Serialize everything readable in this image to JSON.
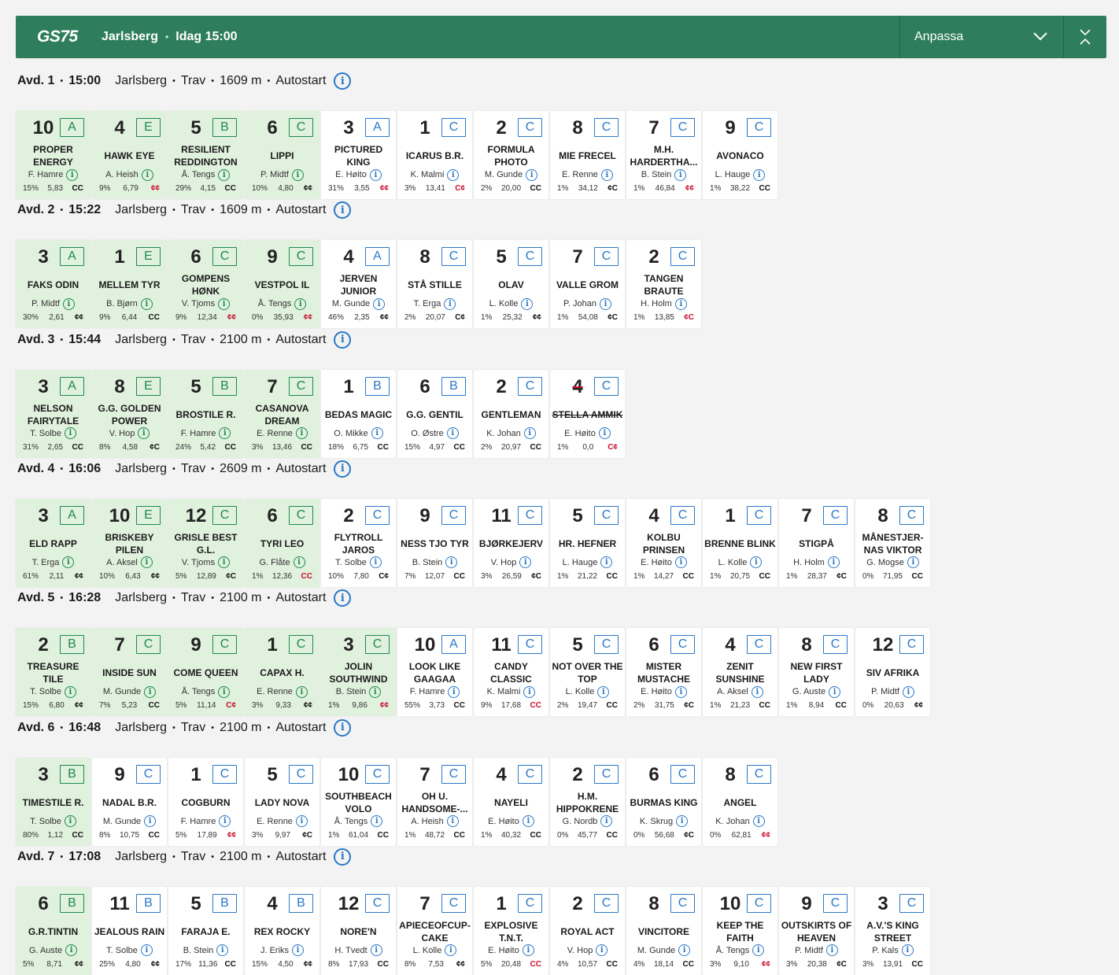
{
  "header": {
    "logo": "GS75",
    "track": "Jarlsberg",
    "time": "Idag 15:00",
    "customize_label": "Anpassa"
  },
  "races": [
    {
      "label": "Avd. 1",
      "time": "15:00",
      "track": "Jarlsberg",
      "type": "Trav",
      "distance": "1609 m",
      "start": "Autostart",
      "horses": [
        {
          "num": "10",
          "group": "A",
          "name": "PROPER ENERGY",
          "driver": "F. Hamre",
          "pct": "15%",
          "odds": "5,83",
          "sym": "CC",
          "sel": true
        },
        {
          "num": "4",
          "group": "E",
          "name": "HAWK EYE",
          "driver": "A. Heish",
          "pct": "9%",
          "odds": "6,79",
          "sym": "¢¢",
          "red": true,
          "sel": true
        },
        {
          "num": "5",
          "group": "B",
          "name": "RESILIENT REDDINGTON",
          "driver": "Å. Tengs",
          "pct": "29%",
          "odds": "4,15",
          "sym": "CC",
          "sel": true
        },
        {
          "num": "6",
          "group": "C",
          "name": "LIPPI",
          "driver": "P. Midtf",
          "pct": "10%",
          "odds": "4,80",
          "sym": "¢¢",
          "sel": true
        },
        {
          "num": "3",
          "group": "A",
          "name": "PICTURED KING",
          "driver": "E. Høito",
          "pct": "31%",
          "odds": "3,55",
          "sym": "¢¢",
          "red": true
        },
        {
          "num": "1",
          "group": "C",
          "name": "ICARUS B.R.",
          "driver": "K. Malmi",
          "pct": "3%",
          "odds": "13,41",
          "sym": "C¢",
          "red": true
        },
        {
          "num": "2",
          "group": "C",
          "name": "FORMULA PHOTO",
          "driver": "M. Gunde",
          "pct": "2%",
          "odds": "20,00",
          "sym": "CC"
        },
        {
          "num": "8",
          "group": "C",
          "name": "MIE FRECEL",
          "driver": "E. Renne",
          "pct": "1%",
          "odds": "34,12",
          "sym": "¢C"
        },
        {
          "num": "7",
          "group": "C",
          "name": "M.H. HARDERTHA...",
          "driver": "B. Stein",
          "pct": "1%",
          "odds": "46,84",
          "sym": "¢¢",
          "red": true
        },
        {
          "num": "9",
          "group": "C",
          "name": "AVONACO",
          "driver": "L. Hauge",
          "pct": "1%",
          "odds": "38,22",
          "sym": "CC"
        }
      ]
    },
    {
      "label": "Avd. 2",
      "time": "15:22",
      "track": "Jarlsberg",
      "type": "Trav",
      "distance": "1609 m",
      "start": "Autostart",
      "horses": [
        {
          "num": "3",
          "group": "A",
          "name": "FAKS ODIN",
          "driver": "P. Midtf",
          "pct": "30%",
          "odds": "2,61",
          "sym": "¢¢",
          "sel": true
        },
        {
          "num": "1",
          "group": "E",
          "name": "MELLEM TYR",
          "driver": "B. Bjørn",
          "pct": "9%",
          "odds": "6,44",
          "sym": "CC",
          "sel": true
        },
        {
          "num": "6",
          "group": "C",
          "name": "GOMPENS HØNK",
          "driver": "V. Tjoms",
          "pct": "9%",
          "odds": "12,34",
          "sym": "¢¢",
          "red": true,
          "sel": true
        },
        {
          "num": "9",
          "group": "C",
          "name": "VESTPOL IL",
          "driver": "Å. Tengs",
          "pct": "0%",
          "odds": "35,93",
          "sym": "¢¢",
          "red": true,
          "sel": true
        },
        {
          "num": "4",
          "group": "A",
          "name": "JERVEN JUNIOR",
          "driver": "M. Gunde",
          "pct": "46%",
          "odds": "2,35",
          "sym": "¢¢"
        },
        {
          "num": "8",
          "group": "C",
          "name": "STÅ STILLE",
          "driver": "T. Erga",
          "pct": "2%",
          "odds": "20,07",
          "sym": "C¢"
        },
        {
          "num": "5",
          "group": "C",
          "name": "OLAV",
          "driver": "L. Kolle",
          "pct": "1%",
          "odds": "25,32",
          "sym": "¢¢"
        },
        {
          "num": "7",
          "group": "C",
          "name": "VALLE GROM",
          "driver": "P. Johan",
          "pct": "1%",
          "odds": "54,08",
          "sym": "¢C"
        },
        {
          "num": "2",
          "group": "C",
          "name": "TANGEN BRAUTE",
          "driver": "H. Holm",
          "pct": "1%",
          "odds": "13,85",
          "sym": "¢C",
          "red": true
        }
      ]
    },
    {
      "label": "Avd. 3",
      "time": "15:44",
      "track": "Jarlsberg",
      "type": "Trav",
      "distance": "2100 m",
      "start": "Autostart",
      "horses": [
        {
          "num": "3",
          "group": "A",
          "name": "NELSON FAIRYTALE",
          "driver": "T. Solbe",
          "pct": "31%",
          "odds": "2,65",
          "sym": "CC",
          "sel": true
        },
        {
          "num": "8",
          "group": "E",
          "name": "G.G. GOLDEN POWER",
          "driver": "V. Hop",
          "pct": "8%",
          "odds": "4,58",
          "sym": "¢C",
          "sel": true
        },
        {
          "num": "5",
          "group": "B",
          "name": "BROSTILE R.",
          "driver": "F. Hamre",
          "pct": "24%",
          "odds": "5,42",
          "sym": "CC",
          "sel": true
        },
        {
          "num": "7",
          "group": "C",
          "name": "CASANOVA DREAM",
          "driver": "E. Renne",
          "pct": "3%",
          "odds": "13,46",
          "sym": "CC",
          "sel": true
        },
        {
          "num": "1",
          "group": "B",
          "name": "BEDAS MAGIC",
          "driver": "O. Mikke",
          "pct": "18%",
          "odds": "6,75",
          "sym": "CC"
        },
        {
          "num": "6",
          "group": "B",
          "name": "G.G. GENTIL",
          "driver": "O. Østre",
          "pct": "15%",
          "odds": "4,97",
          "sym": "CC"
        },
        {
          "num": "2",
          "group": "C",
          "name": "GENTLEMAN",
          "driver": "K. Johan",
          "pct": "2%",
          "odds": "20,97",
          "sym": "CC"
        },
        {
          "num": "4",
          "group": "C",
          "name": "STELLA AMMIK",
          "driver": "E. Høito",
          "pct": "1%",
          "odds": "0,0",
          "sym": "C¢",
          "red": true,
          "scr": true
        }
      ]
    },
    {
      "label": "Avd. 4",
      "time": "16:06",
      "track": "Jarlsberg",
      "type": "Trav",
      "distance": "2609 m",
      "start": "Autostart",
      "horses": [
        {
          "num": "3",
          "group": "A",
          "name": "ELD RAPP",
          "driver": "T. Erga",
          "pct": "61%",
          "odds": "2,11",
          "sym": "¢¢",
          "sel": true
        },
        {
          "num": "10",
          "group": "E",
          "name": "BRISKEBY PILEN",
          "driver": "A. Aksel",
          "pct": "10%",
          "odds": "6,43",
          "sym": "¢¢",
          "sel": true
        },
        {
          "num": "12",
          "group": "C",
          "name": "GRISLE BEST G.L.",
          "driver": "V. Tjoms",
          "pct": "5%",
          "odds": "12,89",
          "sym": "¢C",
          "sel": true
        },
        {
          "num": "6",
          "group": "C",
          "name": "TYRI LEO",
          "driver": "G. Flåte",
          "pct": "1%",
          "odds": "12,36",
          "sym": "CC",
          "red": true,
          "sel": true
        },
        {
          "num": "2",
          "group": "C",
          "name": "FLYTROLL JAROS",
          "driver": "T. Solbe",
          "pct": "10%",
          "odds": "7,80",
          "sym": "C¢"
        },
        {
          "num": "9",
          "group": "C",
          "name": "NESS TJO TYR",
          "driver": "B. Stein",
          "pct": "7%",
          "odds": "12,07",
          "sym": "CC"
        },
        {
          "num": "11",
          "group": "C",
          "name": "BJØRKEJERV",
          "driver": "V. Hop",
          "pct": "3%",
          "odds": "26,59",
          "sym": "¢C"
        },
        {
          "num": "5",
          "group": "C",
          "name": "HR. HEFNER",
          "driver": "L. Hauge",
          "pct": "1%",
          "odds": "21,22",
          "sym": "CC"
        },
        {
          "num": "4",
          "group": "C",
          "name": "KOLBU PRINSEN",
          "driver": "E. Høito",
          "pct": "1%",
          "odds": "14,27",
          "sym": "CC"
        },
        {
          "num": "1",
          "group": "C",
          "name": "BRENNE BLINK",
          "driver": "L. Kolle",
          "pct": "1%",
          "odds": "20,75",
          "sym": "CC"
        },
        {
          "num": "7",
          "group": "C",
          "name": "STIGPÅ",
          "driver": "H. Holm",
          "pct": "1%",
          "odds": "28,37",
          "sym": "¢C"
        },
        {
          "num": "8",
          "group": "C",
          "name": "MÅNESTJER-NAS VIKTOR",
          "driver": "G. Mogse",
          "pct": "0%",
          "odds": "71,95",
          "sym": "CC"
        }
      ]
    },
    {
      "label": "Avd. 5",
      "time": "16:28",
      "track": "Jarlsberg",
      "type": "Trav",
      "distance": "2100 m",
      "start": "Autostart",
      "horses": [
        {
          "num": "2",
          "group": "B",
          "name": "TREASURE TILE",
          "driver": "T. Solbe",
          "pct": "15%",
          "odds": "6,80",
          "sym": "¢¢",
          "sel": true
        },
        {
          "num": "7",
          "group": "C",
          "name": "INSIDE SUN",
          "driver": "M. Gunde",
          "pct": "7%",
          "odds": "5,23",
          "sym": "CC",
          "sel": true
        },
        {
          "num": "9",
          "group": "C",
          "name": "COME QUEEN",
          "driver": "Å. Tengs",
          "pct": "5%",
          "odds": "11,14",
          "sym": "C¢",
          "red": true,
          "sel": true
        },
        {
          "num": "1",
          "group": "C",
          "name": "CAPAX H.",
          "driver": "E. Renne",
          "pct": "3%",
          "odds": "9,33",
          "sym": "¢¢",
          "sel": true
        },
        {
          "num": "3",
          "group": "C",
          "name": "JOLIN SOUTHWIND",
          "driver": "B. Stein",
          "pct": "1%",
          "odds": "9,86",
          "sym": "¢¢",
          "red": true,
          "sel": true
        },
        {
          "num": "10",
          "group": "A",
          "name": "LOOK LIKE GAAGAA",
          "driver": "F. Hamre",
          "pct": "55%",
          "odds": "3,73",
          "sym": "CC"
        },
        {
          "num": "11",
          "group": "C",
          "name": "CANDY CLASSIC",
          "driver": "K. Malmi",
          "pct": "9%",
          "odds": "17,68",
          "sym": "CC",
          "red": true
        },
        {
          "num": "5",
          "group": "C",
          "name": "NOT OVER THE TOP",
          "driver": "L. Kolle",
          "pct": "2%",
          "odds": "19,47",
          "sym": "CC"
        },
        {
          "num": "6",
          "group": "C",
          "name": "MISTER MUSTACHE",
          "driver": "E. Høito",
          "pct": "2%",
          "odds": "31,75",
          "sym": "¢C"
        },
        {
          "num": "4",
          "group": "C",
          "name": "ZENIT SUNSHINE",
          "driver": "A. Aksel",
          "pct": "1%",
          "odds": "21,23",
          "sym": "CC"
        },
        {
          "num": "8",
          "group": "C",
          "name": "NEW FIRST LADY",
          "driver": "G. Auste",
          "pct": "1%",
          "odds": "8,94",
          "sym": "CC"
        },
        {
          "num": "12",
          "group": "C",
          "name": "SIV AFRIKA",
          "driver": "P. Midtf",
          "pct": "0%",
          "odds": "20,63",
          "sym": "¢¢"
        }
      ]
    },
    {
      "label": "Avd. 6",
      "time": "16:48",
      "track": "Jarlsberg",
      "type": "Trav",
      "distance": "2100 m",
      "start": "Autostart",
      "horses": [
        {
          "num": "3",
          "group": "B",
          "name": "TIMESTILE R.",
          "driver": "T. Solbe",
          "pct": "80%",
          "odds": "1,12",
          "sym": "CC",
          "sel": true
        },
        {
          "num": "9",
          "group": "C",
          "name": "NADAL B.R.",
          "driver": "M. Gunde",
          "pct": "8%",
          "odds": "10,75",
          "sym": "CC"
        },
        {
          "num": "1",
          "group": "C",
          "name": "COGBURN",
          "driver": "F. Hamre",
          "pct": "5%",
          "odds": "17,89",
          "sym": "¢¢",
          "red": true
        },
        {
          "num": "5",
          "group": "C",
          "name": "LADY NOVA",
          "driver": "E. Renne",
          "pct": "3%",
          "odds": "9,97",
          "sym": "¢C"
        },
        {
          "num": "10",
          "group": "C",
          "name": "SOUTHBEACH VOLO",
          "driver": "Å. Tengs",
          "pct": "1%",
          "odds": "61,04",
          "sym": "CC"
        },
        {
          "num": "7",
          "group": "C",
          "name": "OH U. HANDSOME-...",
          "driver": "A. Heish",
          "pct": "1%",
          "odds": "48,72",
          "sym": "CC"
        },
        {
          "num": "4",
          "group": "C",
          "name": "NAYELI",
          "driver": "E. Høito",
          "pct": "1%",
          "odds": "40,32",
          "sym": "CC"
        },
        {
          "num": "2",
          "group": "C",
          "name": "H.M. HIPPOKRENE",
          "driver": "G. Nordb",
          "pct": "0%",
          "odds": "45,77",
          "sym": "CC"
        },
        {
          "num": "6",
          "group": "C",
          "name": "BURMAS KING",
          "driver": "K. Skrug",
          "pct": "0%",
          "odds": "56,68",
          "sym": "¢C"
        },
        {
          "num": "8",
          "group": "C",
          "name": "ANGEL",
          "driver": "K. Johan",
          "pct": "0%",
          "odds": "62,81",
          "sym": "¢¢",
          "red": true
        }
      ]
    },
    {
      "label": "Avd. 7",
      "time": "17:08",
      "track": "Jarlsberg",
      "type": "Trav",
      "distance": "2100 m",
      "start": "Autostart",
      "horses": [
        {
          "num": "6",
          "group": "B",
          "name": "G.R.TINTIN",
          "driver": "G. Auste",
          "pct": "5%",
          "odds": "8,71",
          "sym": "¢¢",
          "sel": true
        },
        {
          "num": "11",
          "group": "B",
          "name": "JEALOUS RAIN",
          "driver": "T. Solbe",
          "pct": "25%",
          "odds": "4,80",
          "sym": "¢¢"
        },
        {
          "num": "5",
          "group": "B",
          "name": "FARAJA E.",
          "driver": "B. Stein",
          "pct": "17%",
          "odds": "11,36",
          "sym": "CC"
        },
        {
          "num": "4",
          "group": "B",
          "name": "REX ROCKY",
          "driver": "J. Eriks",
          "pct": "15%",
          "odds": "4,50",
          "sym": "¢¢"
        },
        {
          "num": "12",
          "group": "C",
          "name": "NORE'N",
          "driver": "H. Tvedt",
          "pct": "8%",
          "odds": "17,93",
          "sym": "CC"
        },
        {
          "num": "7",
          "group": "C",
          "name": "APIECEOFCUP-CAKE",
          "driver": "L. Kolle",
          "pct": "8%",
          "odds": "7,53",
          "sym": "¢¢"
        },
        {
          "num": "1",
          "group": "C",
          "name": "EXPLOSIVE T.N.T.",
          "driver": "E. Høito",
          "pct": "5%",
          "odds": "20,48",
          "sym": "CC",
          "red": true
        },
        {
          "num": "2",
          "group": "C",
          "name": "ROYAL ACT",
          "driver": "V. Hop",
          "pct": "4%",
          "odds": "10,57",
          "sym": "CC"
        },
        {
          "num": "8",
          "group": "C",
          "name": "VINCITORE",
          "driver": "M. Gunde",
          "pct": "4%",
          "odds": "18,14",
          "sym": "CC"
        },
        {
          "num": "10",
          "group": "C",
          "name": "KEEP THE FAITH",
          "driver": "Å. Tengs",
          "pct": "3%",
          "odds": "9,10",
          "sym": "¢¢",
          "red": true
        },
        {
          "num": "9",
          "group": "C",
          "name": "OUTSKIRTS OF HEAVEN",
          "driver": "P. Midtf",
          "pct": "3%",
          "odds": "20,38",
          "sym": "¢C"
        },
        {
          "num": "3",
          "group": "C",
          "name": "A.V.'S KING STREET",
          "driver": "P. Kals",
          "pct": "3%",
          "odds": "13,91",
          "sym": "CC"
        }
      ]
    }
  ]
}
